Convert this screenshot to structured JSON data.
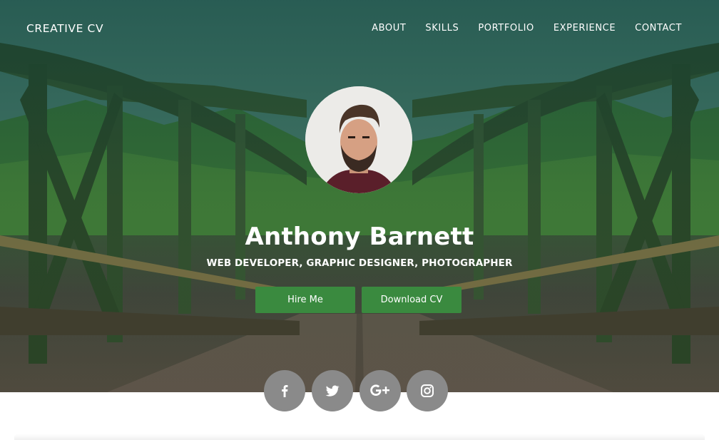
{
  "navbar": {
    "brand": "CREATIVE CV",
    "items": [
      {
        "label": "ABOUT"
      },
      {
        "label": "SKILLS"
      },
      {
        "label": "PORTFOLIO"
      },
      {
        "label": "EXPERIENCE"
      },
      {
        "label": "CONTACT"
      }
    ]
  },
  "profile": {
    "name": "Anthony Barnett",
    "roles": "WEB DEVELOPER, GRAPHIC DESIGNER, PHOTOGRAPHER"
  },
  "buttons": {
    "hire_label": "Hire Me",
    "download_label": "Download CV"
  },
  "social": [
    {
      "icon": "facebook-icon"
    },
    {
      "icon": "twitter-icon"
    },
    {
      "icon": "google-plus-icon"
    },
    {
      "icon": "instagram-icon"
    }
  ],
  "colors": {
    "accent": "#3a8a3f",
    "social_bg": "#8a8a8a",
    "text": "#ffffff"
  }
}
